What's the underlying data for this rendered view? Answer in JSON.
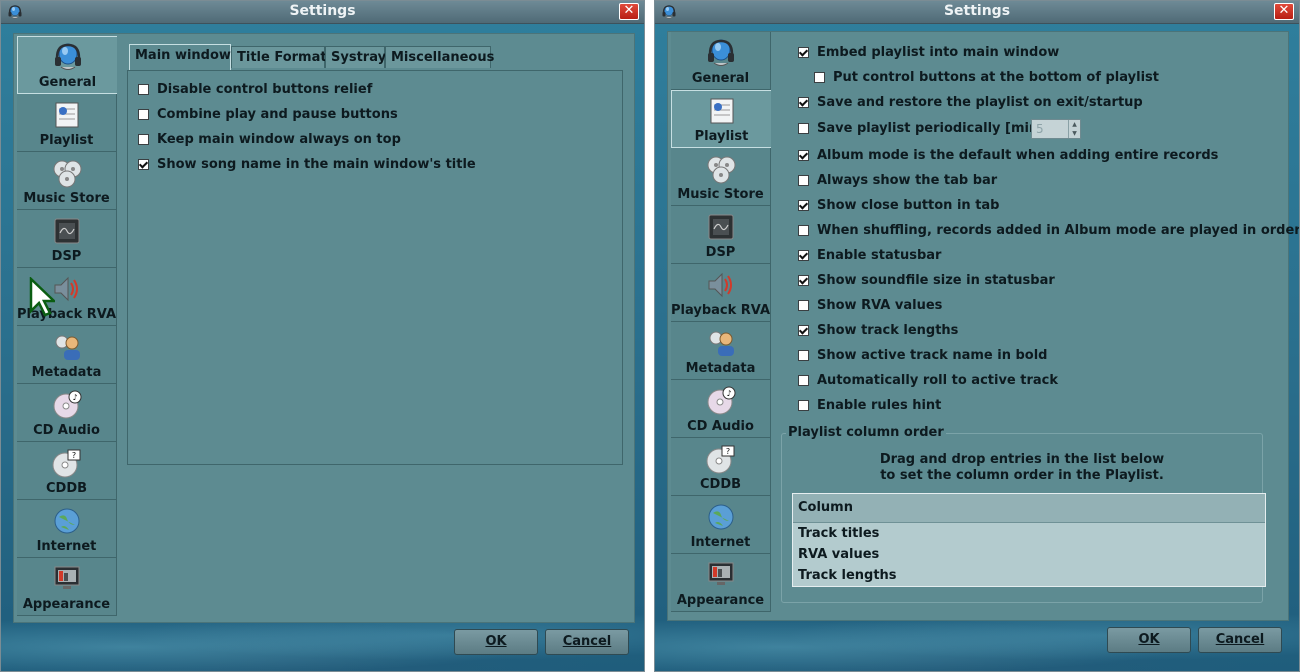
{
  "window_left": {
    "title": "Settings",
    "close_label": "✕",
    "sidebar": [
      {
        "label": "General",
        "icon": "headphones-icon"
      },
      {
        "label": "Playlist",
        "icon": "playlist-icon"
      },
      {
        "label": "Music Store",
        "icon": "music-store-icon"
      },
      {
        "label": "DSP",
        "icon": "dsp-chip-icon"
      },
      {
        "label": "Playback RVA",
        "icon": "speaker-icon"
      },
      {
        "label": "Metadata",
        "icon": "metadata-person-icon"
      },
      {
        "label": "CD Audio",
        "icon": "cd-audio-icon"
      },
      {
        "label": "CDDB",
        "icon": "cddb-icon"
      },
      {
        "label": "Internet",
        "icon": "globe-icon"
      },
      {
        "label": "Appearance",
        "icon": "monitor-icon"
      }
    ],
    "active_sidebar": "General",
    "tabs": [
      "Main window",
      "Title Format",
      "Systray",
      "Miscellaneous"
    ],
    "active_tab": "Main window",
    "options": [
      {
        "label": "Disable control buttons relief",
        "checked": false
      },
      {
        "label": "Combine play and pause buttons",
        "checked": false
      },
      {
        "label": "Keep main window always on top",
        "checked": false
      },
      {
        "label": "Show song name in the main window's title",
        "checked": true
      }
    ],
    "ok_label": "OK",
    "cancel_label": "Cancel"
  },
  "window_right": {
    "title": "Settings",
    "close_label": "✕",
    "active_sidebar": "Playlist",
    "options": [
      {
        "label": "Embed playlist into main window",
        "checked": true
      },
      {
        "label": "Put control buttons at the bottom of playlist",
        "checked": false
      },
      {
        "label": "Save and restore the playlist on exit/startup",
        "checked": true
      },
      {
        "label": "Save playlist periodically [min]:",
        "checked": false
      },
      {
        "label": "Album mode is the default when adding entire records",
        "checked": true
      },
      {
        "label": "Always show the tab bar",
        "checked": false
      },
      {
        "label": "Show close button in tab",
        "checked": true
      },
      {
        "label": "When shuffling, records added in Album mode are played in order",
        "checked": false
      },
      {
        "label": "Enable statusbar",
        "checked": true
      },
      {
        "label": "Show soundfile size in statusbar",
        "checked": true
      },
      {
        "label": "Show RVA values",
        "checked": false
      },
      {
        "label": "Show track lengths",
        "checked": true
      },
      {
        "label": "Show active track name in bold",
        "checked": false
      },
      {
        "label": "Automatically roll to active track",
        "checked": false
      },
      {
        "label": "Enable rules hint",
        "checked": false
      }
    ],
    "save_interval_value": "5",
    "column_order": {
      "title": "Playlist column order",
      "description_line1": "Drag and drop entries in the list below",
      "description_line2": "to set the column order in the Playlist.",
      "header": "Column",
      "rows": [
        "Track titles",
        "RVA values",
        "Track lengths"
      ]
    },
    "ok_label": "OK",
    "cancel_label": "Cancel"
  },
  "colors": {
    "accent": "#2a6e8c",
    "panel": "#5d8b91",
    "close": "#c8281c"
  }
}
